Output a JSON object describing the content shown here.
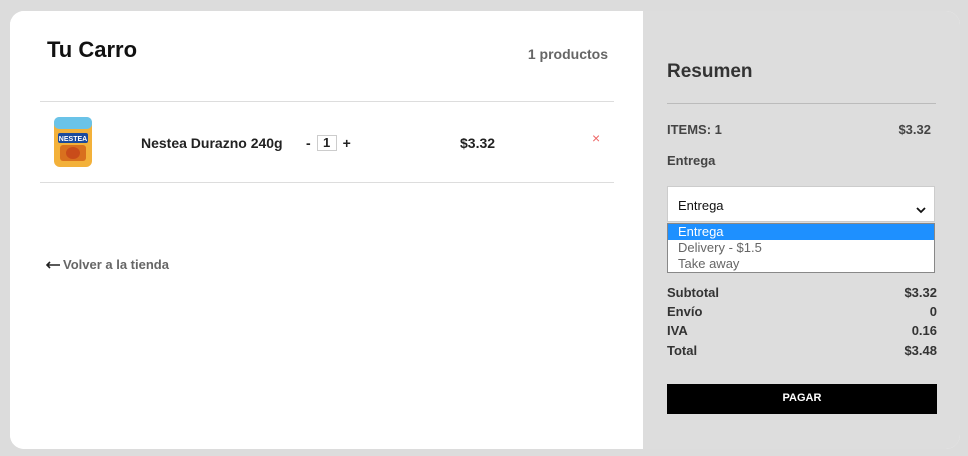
{
  "cart": {
    "title": "Tu Carro",
    "count": "1 productos",
    "items": [
      {
        "name": "Nestea Durazno 240g",
        "quantity": "1",
        "minus": "-",
        "plus": "+",
        "price": "$3.32",
        "remove": "×",
        "image_text": "NESTEA"
      }
    ],
    "back_label": "Volver a la tienda"
  },
  "summary": {
    "title": "Resumen",
    "items_label": "ITEMS: 1",
    "items_value": "$3.32",
    "delivery_label": "Entrega",
    "delivery_selected": "Entrega",
    "delivery_options": [
      "Entrega",
      "Delivery - $1.5",
      "Take away"
    ],
    "subtotal_label": "Subtotal",
    "subtotal_value": "$3.32",
    "shipping_label": "Envío",
    "shipping_value": "0",
    "tax_label": "IVA",
    "tax_value": "0.16",
    "total_label": "Total",
    "total_value": "$3.48",
    "pay_label": "PAGAR"
  },
  "colors": {
    "background": "#dcdcdc",
    "summary_bg": "#dddddd",
    "selected_option": "#1e90ff",
    "remove_icon": "#e66666",
    "pay_button": "#000000"
  }
}
